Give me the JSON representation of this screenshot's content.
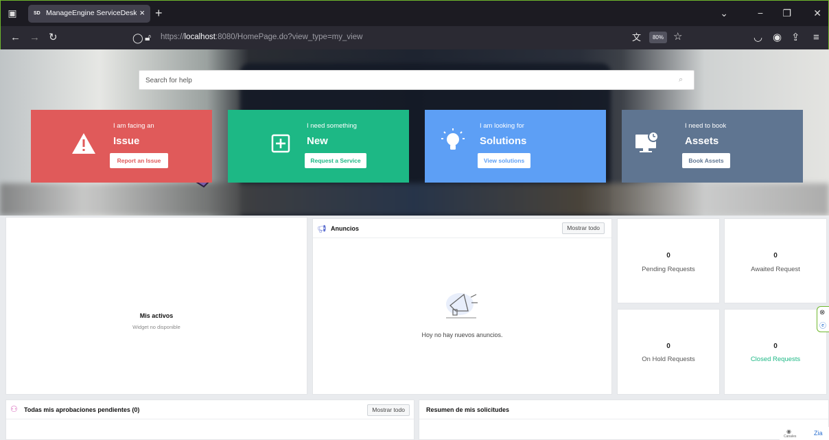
{
  "browser": {
    "tab_favicon": "SD",
    "tab_title": "ManageEngine ServiceDesk Plu",
    "tab_close": "×",
    "new_tab": "+",
    "url_prefix": "https://",
    "url_host": "localhost",
    "url_rest": ":8080/HomePage.do?view_type=my_view",
    "zoom": "80%"
  },
  "search": {
    "placeholder": "Search for help"
  },
  "cards": [
    {
      "small": "I am facing an",
      "big": "Issue",
      "button": "Report an Issue",
      "color": "#e05a5a",
      "icon": "warning-icon"
    },
    {
      "small": "I need something",
      "big": "New",
      "button": "Request a Service",
      "color": "#1db885",
      "icon": "plus-icon"
    },
    {
      "small": "I am looking for",
      "big": "Solutions",
      "button": "View solutions",
      "color": "#5d9ff5",
      "icon": "lightbulb-icon"
    },
    {
      "small": "I need to book",
      "big": "Assets",
      "button": "Book Assets",
      "color": "#5f7591",
      "icon": "monitor-clock-icon"
    }
  ],
  "widgets": {
    "assets": {
      "title": "Mis activos",
      "subtitle": "Widget no disponible"
    },
    "announcements": {
      "title": "Anuncios",
      "show_all": "Mostrar todo",
      "empty": "Hoy no hay nuevos anuncios."
    },
    "stats": [
      {
        "count": "0",
        "label": "Pending Requests",
        "color": "#555555"
      },
      {
        "count": "0",
        "label": "Awaited Request",
        "color": "#555555"
      },
      {
        "count": "0",
        "label": "On Hold Requests",
        "color": "#555555"
      },
      {
        "count": "0",
        "label": "Closed Requests",
        "color": "#1db885"
      }
    ],
    "approvals": {
      "title": "Todas mis aprobaciones pendientes (0)",
      "show_all": "Mostrar todo"
    },
    "summary": {
      "title": "Resumen de mis solicitudes"
    }
  },
  "footer": {
    "channels": "Canales",
    "extra": "Zia"
  },
  "colors": {
    "accent_green": "#6fb82d",
    "arrow": "#7b5ea8"
  }
}
